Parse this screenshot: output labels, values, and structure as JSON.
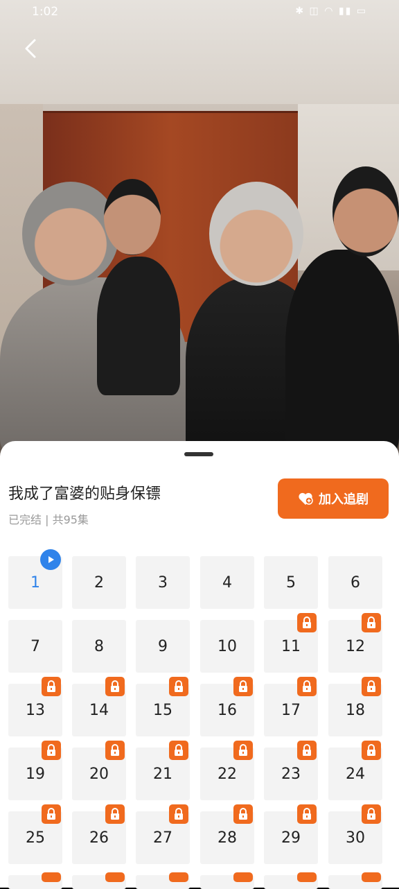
{
  "status_bar": {
    "time": "1:02",
    "icons": "✱ ◫ ◠ ▮▮ ▭"
  },
  "show": {
    "title": "我成了富婆的贴身保镖",
    "status": "已完结 | 共95集",
    "follow_label": "加入追剧"
  },
  "episodes": [
    {
      "n": "1",
      "locked": false,
      "current": true
    },
    {
      "n": "2",
      "locked": false
    },
    {
      "n": "3",
      "locked": false
    },
    {
      "n": "4",
      "locked": false
    },
    {
      "n": "5",
      "locked": false
    },
    {
      "n": "6",
      "locked": false
    },
    {
      "n": "7",
      "locked": false
    },
    {
      "n": "8",
      "locked": false
    },
    {
      "n": "9",
      "locked": false
    },
    {
      "n": "10",
      "locked": false
    },
    {
      "n": "11",
      "locked": true
    },
    {
      "n": "12",
      "locked": true
    },
    {
      "n": "13",
      "locked": true
    },
    {
      "n": "14",
      "locked": true
    },
    {
      "n": "15",
      "locked": true
    },
    {
      "n": "16",
      "locked": true
    },
    {
      "n": "17",
      "locked": true
    },
    {
      "n": "18",
      "locked": true
    },
    {
      "n": "19",
      "locked": true
    },
    {
      "n": "20",
      "locked": true
    },
    {
      "n": "21",
      "locked": true
    },
    {
      "n": "22",
      "locked": true
    },
    {
      "n": "23",
      "locked": true
    },
    {
      "n": "24",
      "locked": true
    },
    {
      "n": "25",
      "locked": true
    },
    {
      "n": "26",
      "locked": true
    },
    {
      "n": "27",
      "locked": true
    },
    {
      "n": "28",
      "locked": true
    },
    {
      "n": "29",
      "locked": true
    },
    {
      "n": "30",
      "locked": true
    }
  ],
  "colors": {
    "accent": "#f06a1e",
    "current": "#2f83ea"
  }
}
